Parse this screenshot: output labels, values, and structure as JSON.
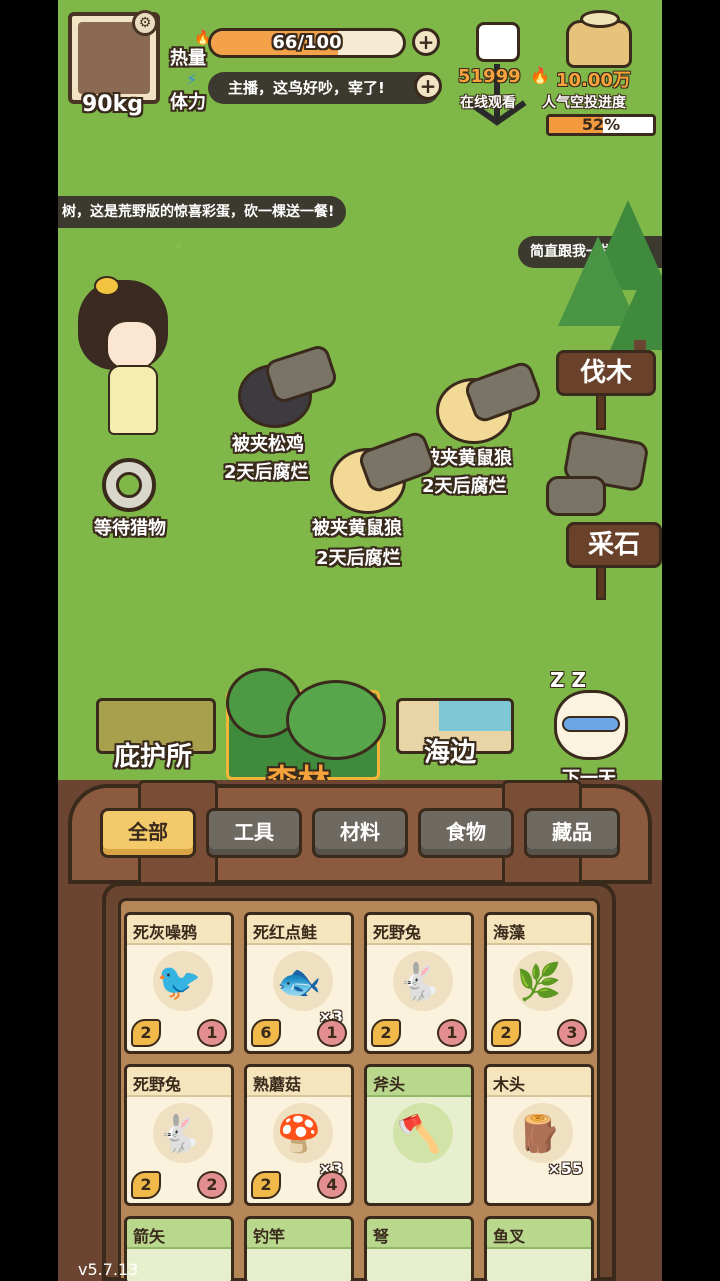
{
  "hud": {
    "weight": "90kg",
    "heat_label": "热量",
    "stamina_label": "体力",
    "heat_value": "66/100",
    "heat_fraction": 0.66,
    "stamina_ticker": "主播，这鸟好吵，宰了!",
    "viewers": "51999",
    "viewers_label": "在线观看",
    "popularity": "10.00万",
    "popularity_label": "人气空投进度",
    "airdrop_progress": "52%",
    "airdrop_fraction": 0.52
  },
  "chat": {
    "bubble1": "树，这是荒野版的惊喜彩蛋，砍一棵送一餐!",
    "bubble2": "简直跟我一样可爱"
  },
  "field": {
    "sign_chop": "伐木",
    "sign_mine": "采石",
    "trap_status": "等待猎物",
    "catch1_name": "被夹松鸡",
    "catch1_rot": "2天后腐烂",
    "catch2_name": "被夹黄鼠狼",
    "catch2_rot": "2天后腐烂",
    "catch3_name": "被夹黄鼠狼",
    "catch3_rot": "2天后腐烂"
  },
  "locations": {
    "shelter": "庇护所",
    "forest": "森林",
    "beach": "海边",
    "next_day": "下一天"
  },
  "tabs": [
    "全部",
    "工具",
    "材料",
    "食物",
    "藏品"
  ],
  "inventory": [
    {
      "name": "死灰噪鸦",
      "icon": "🐦",
      "qty": "",
      "left": "2",
      "right": "1",
      "tool": false
    },
    {
      "name": "死红点鲑",
      "icon": "🐟",
      "qty": "×3",
      "left": "6",
      "right": "1",
      "tool": false
    },
    {
      "name": "死野兔",
      "icon": "🐇",
      "qty": "",
      "left": "2",
      "right": "1",
      "tool": false
    },
    {
      "name": "海藻",
      "icon": "🌿",
      "qty": "",
      "left": "2",
      "right": "3",
      "tool": false
    },
    {
      "name": "死野兔",
      "icon": "🐇",
      "qty": "",
      "left": "2",
      "right": "2",
      "tool": false
    },
    {
      "name": "熟蘑菇",
      "icon": "🍄",
      "qty": "×3",
      "left": "2",
      "right": "4",
      "tool": false
    },
    {
      "name": "斧头",
      "icon": "🪓",
      "qty": "",
      "left": "",
      "right": "",
      "tool": true
    },
    {
      "name": "木头",
      "icon": "🪵",
      "qty": "×55",
      "left": "",
      "right": "",
      "tool": false
    },
    {
      "name": "箭矢",
      "icon": "",
      "qty": "",
      "left": "",
      "right": "",
      "tool": true
    },
    {
      "name": "钓竿",
      "icon": "",
      "qty": "",
      "left": "",
      "right": "",
      "tool": true
    },
    {
      "name": "弩",
      "icon": "",
      "qty": "",
      "left": "",
      "right": "",
      "tool": true
    },
    {
      "name": "鱼叉",
      "icon": "",
      "qty": "",
      "left": "",
      "right": "",
      "tool": true
    }
  ],
  "version": "v5.7.13",
  "colors": {
    "grass": "#7fb848",
    "accent_orange": "#f4a24a",
    "outline": "#3a2a1c",
    "tab_active": "#f4c96a"
  }
}
